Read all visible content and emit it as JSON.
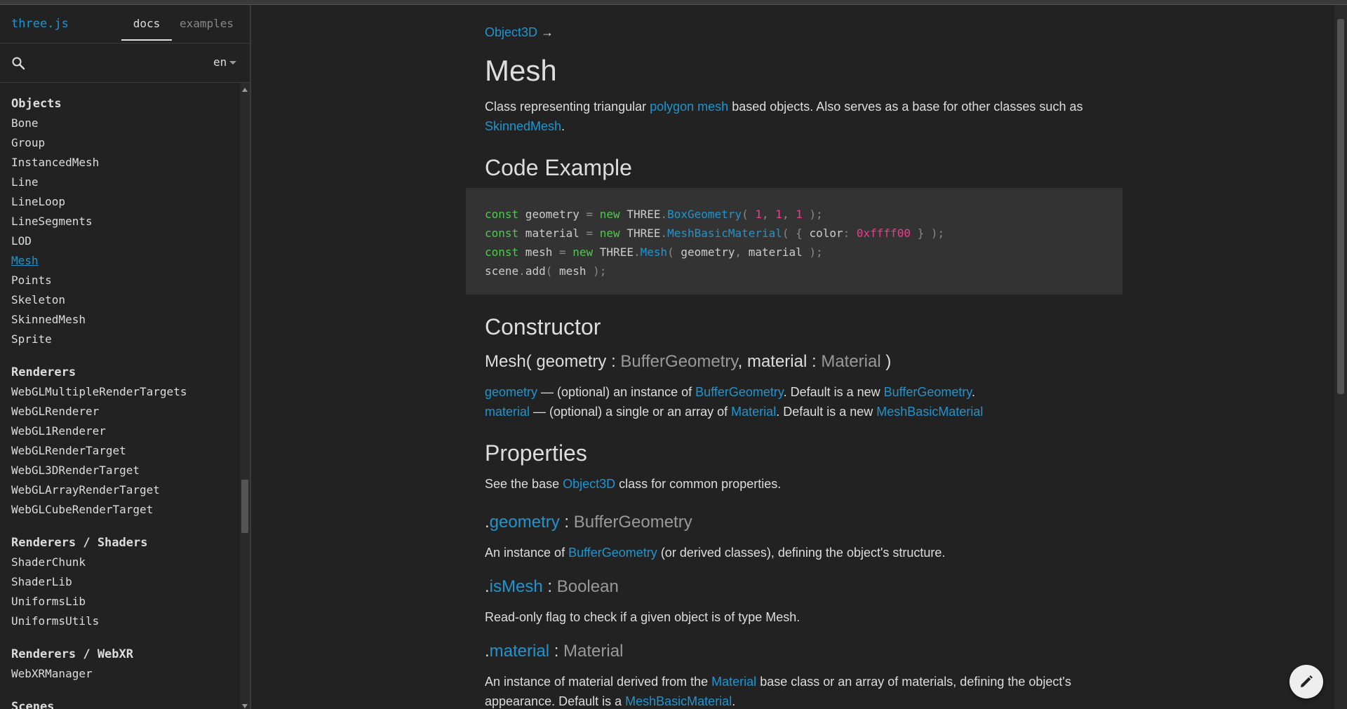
{
  "header": {
    "brand": "three.js",
    "tabs": [
      {
        "label": "docs"
      },
      {
        "label": "examples"
      }
    ]
  },
  "search": {
    "placeholder": "",
    "language": "en"
  },
  "sidebar": {
    "groups": [
      {
        "title": "Objects",
        "items": [
          "Bone",
          "Group",
          "InstancedMesh",
          "Line",
          "LineLoop",
          "LineSegments",
          "LOD",
          "Mesh",
          "Points",
          "Skeleton",
          "SkinnedMesh",
          "Sprite"
        ],
        "selected": "Mesh"
      },
      {
        "title": "Renderers",
        "items": [
          "WebGLMultipleRenderTargets",
          "WebGLRenderer",
          "WebGL1Renderer",
          "WebGLRenderTarget",
          "WebGL3DRenderTarget",
          "WebGLArrayRenderTarget",
          "WebGLCubeRenderTarget"
        ]
      },
      {
        "title": "Renderers / Shaders",
        "items": [
          "ShaderChunk",
          "ShaderLib",
          "UniformsLib",
          "UniformsUtils"
        ]
      },
      {
        "title": "Renderers / WebXR",
        "items": [
          "WebXRManager"
        ]
      },
      {
        "title": "Scenes",
        "items": []
      }
    ]
  },
  "content": {
    "breadcrumb": {
      "parent": "Object3D",
      "arrow": "→"
    },
    "title": "Mesh",
    "intro": {
      "t1": "Class representing triangular ",
      "link1": "polygon mesh",
      "t2": " based objects. Also serves as a base for other classes such as ",
      "link2": "SkinnedMesh",
      "t3": "."
    },
    "code_example": {
      "heading": "Code Example",
      "lines": [
        "const geometry = new THREE.BoxGeometry( 1, 1, 1 );",
        "const material = new THREE.MeshBasicMaterial( { color: 0xffff00 } );",
        "const mesh = new THREE.Mesh( geometry, material );",
        "scene.add( mesh );"
      ]
    },
    "constructor": {
      "heading": "Constructor",
      "sig_name": "Mesh( ",
      "p1": "geometry",
      "sep1": " : ",
      "t1": "BufferGeometry",
      "comma": ", ",
      "p2": "material",
      "sep2": " : ",
      "t2": "Material",
      "close": " )",
      "desc1": {
        "param": "geometry",
        "text": " — (optional) an instance of ",
        "link": "BufferGeometry",
        "text2": ". Default is a new ",
        "link2": "BufferGeometry",
        "end": "."
      },
      "desc2": {
        "param": "material",
        "text": " — (optional) a single or an array of ",
        "link": "Material",
        "text2": ". Default is a new ",
        "link2": "MeshBasicMaterial"
      }
    },
    "properties": {
      "heading": "Properties",
      "intro_t1": "See the base ",
      "intro_link": "Object3D",
      "intro_t2": " class for common properties.",
      "geometry": {
        "dot": ".",
        "name": "geometry",
        "sep": " : ",
        "type": "BufferGeometry",
        "d1": "An instance of ",
        "dlink": "BufferGeometry",
        "d2": " (or derived classes), defining the object's structure."
      },
      "isMesh": {
        "dot": ".",
        "name": "isMesh",
        "sep": " : ",
        "type": "Boolean",
        "desc": "Read-only flag to check if a given object is of type Mesh."
      },
      "material": {
        "dot": ".",
        "name": "material",
        "sep": " : ",
        "type": "Material",
        "d1": "An instance of material derived from the ",
        "dlink": "Material",
        "d2": " base class or an array of materials, defining the object's appearance. Default is a ",
        "dlink2": "MeshBasicMaterial",
        "d3": "."
      }
    }
  },
  "colors": {
    "background": "#222222",
    "accent": "#2194ce",
    "text": "#dddddd",
    "muted": "#999999",
    "code_bg": "#333333"
  },
  "icons": {
    "search": "search-icon",
    "edit": "pencil-icon",
    "lang_caret": "caret-down-icon"
  }
}
